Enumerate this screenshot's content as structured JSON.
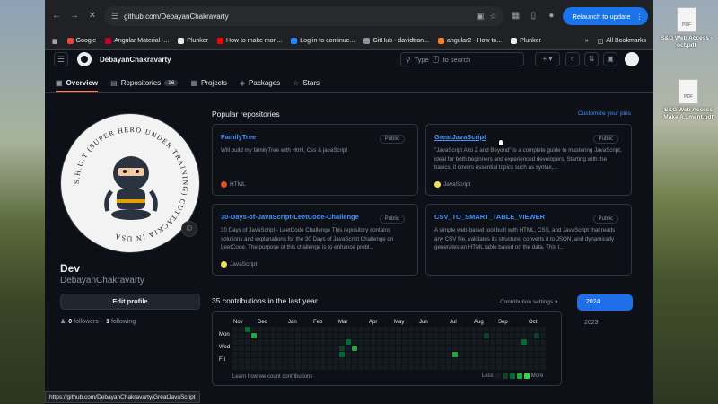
{
  "desktop": {
    "files": [
      {
        "badge": "PDF",
        "name": "S&G Web Access - oct.pdf"
      },
      {
        "badge": "PDF",
        "name": "S&G Web Access Make A...ment.pdf"
      }
    ]
  },
  "browser": {
    "url": "github.com/DebayanChakravarty",
    "relaunch_label": "Relaunch to update",
    "bookmarks": [
      {
        "label": "Google",
        "color": "#ea4335"
      },
      {
        "label": "Angular Material -...",
        "color": "#c3002f"
      },
      {
        "label": "Plunker",
        "color": "#e8eaed"
      },
      {
        "label": "How to make mon...",
        "color": "#ff0000"
      },
      {
        "label": "Log in to continue...",
        "color": "#2684ff"
      },
      {
        "label": "GitHub - davidtran...",
        "color": "#8b949e"
      },
      {
        "label": "angular2 - How to...",
        "color": "#f48024"
      },
      {
        "label": "Plunker",
        "color": "#e8eaed"
      }
    ],
    "all_bookmarks": "All Bookmarks",
    "status_url": "https://github.com/DebayanChakravarty/GreatJavaScript"
  },
  "header": {
    "username": "DebayanChakravarty",
    "search_before": "Type",
    "search_key": "/",
    "search_after": "to search"
  },
  "tabs": [
    {
      "label": "Overview",
      "icon": "book-icon"
    },
    {
      "label": "Repositories",
      "icon": "repo-icon",
      "count": "16"
    },
    {
      "label": "Projects",
      "icon": "table-icon"
    },
    {
      "label": "Packages",
      "icon": "package-icon"
    },
    {
      "label": "Stars",
      "icon": "star-icon"
    }
  ],
  "profile": {
    "name": "Dev",
    "login": "DebayanChakravarty",
    "edit_label": "Edit profile",
    "followers": "0",
    "followers_label": "followers",
    "following": "1",
    "following_label": "following",
    "photo_text": "S.H.U.T (SUPER HERO UNDER TRAINING) CUTTACKIA IN USA"
  },
  "popular": {
    "heading": "Popular repositories",
    "customize": "Customize your pins",
    "visibility": "Public",
    "repos": [
      {
        "name": "FamilyTree",
        "desc": "Will build my familyTree with Html, Css & javaScript",
        "lang": "HTML",
        "color": "#e34c26"
      },
      {
        "name": "GreatJavaScript",
        "desc": "\"JavaScript A to Z and Beyond\" is a complete guide to mastering JavaScript, ideal for both beginners and experienced developers. Starting with the basics, it covers essential topics such as syntax,...",
        "lang": "JavaScript",
        "color": "#f1e05a"
      },
      {
        "name": "30-Days-of-JavaScript-LeetCode-Challenge",
        "desc": "30 Days of JavaScript - LeetCode Challenge This repository contains solutions and explanations for the 30 Days of JavaScript Challenge on LeetCode. The purpose of this challenge is to enhance probl...",
        "lang": "JavaScript",
        "color": "#f1e05a"
      },
      {
        "name": "CSV_TO_SMART_TABLE_VIEWER",
        "desc": "A simple web-based tool built with HTML, CSS, and JavaScript that reads any CSV file, validates its structure, converts it to JSON, and dynamically generates an HTML table based on the data. This t...",
        "lang": "",
        "color": ""
      }
    ]
  },
  "contributions": {
    "heading": "35 contributions in the last year",
    "settings": "Contribution settings",
    "years": [
      "2024",
      "2023"
    ],
    "months": [
      "Nov",
      "Dec",
      "Jan",
      "Feb",
      "Mar",
      "Apr",
      "May",
      "Jun",
      "Jul",
      "Aug",
      "Sep",
      "Oct"
    ],
    "days": [
      "Mon",
      "Wed",
      "Fri"
    ],
    "learn": "Learn how we count contributions",
    "less": "Less",
    "more": "More",
    "colors": [
      "#161b22",
      "#0e4429",
      "#006d32",
      "#26a641",
      "#39d353"
    ]
  }
}
